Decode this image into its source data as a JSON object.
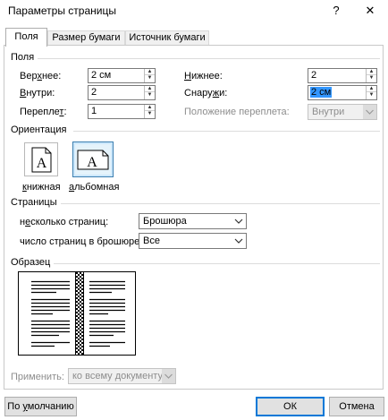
{
  "window": {
    "title": "Параметры страницы",
    "help": "?",
    "close": "✕"
  },
  "tabs": [
    {
      "label": "Поля",
      "active": true
    },
    {
      "label": "Размер бумаги",
      "active": false
    },
    {
      "label": "Источник бумаги",
      "active": false
    }
  ],
  "margins": {
    "section_title": "Поля",
    "top_label_a": "Вер",
    "top_label_u": "х",
    "top_label_b": "нее:",
    "top_value": "2 см",
    "inside_label_u": "В",
    "inside_label_b": "нутри:",
    "inside_value": "2",
    "gutter_label_a": "Перепле",
    "gutter_label_u": "т",
    "gutter_label_b": ":",
    "gutter_value": "1",
    "bottom_label_u": "Н",
    "bottom_label_b": "ижнее:",
    "bottom_value": "2",
    "outside_label_a": "Снару",
    "outside_label_u": "ж",
    "outside_label_b": "и:",
    "outside_value": "2 см",
    "gutter_pos_label": "Положение переплета:",
    "gutter_pos_value": "Внутри"
  },
  "orientation": {
    "section_title": "Ориентация",
    "portrait_label_u": "к",
    "portrait_label_b": "нижная",
    "landscape_label_u": "а",
    "landscape_label_b": "льбомная",
    "glyph": "A"
  },
  "pages": {
    "section_title": "Страницы",
    "multiple_label_a": "н",
    "multiple_label_u": "е",
    "multiple_label_b": "сколько страниц:",
    "multiple_value": "Брошюра",
    "sheets_label": "число страниц в брошюре:",
    "sheets_value": "Все"
  },
  "preview": {
    "section_title": "Образец"
  },
  "apply": {
    "label": "Применить:",
    "value": "ко всему документу"
  },
  "buttons": {
    "default_label_a": "По ",
    "default_label_u": "у",
    "default_label_b": "молчанию",
    "ok_label": "ОК",
    "cancel_label": "Отмена"
  }
}
